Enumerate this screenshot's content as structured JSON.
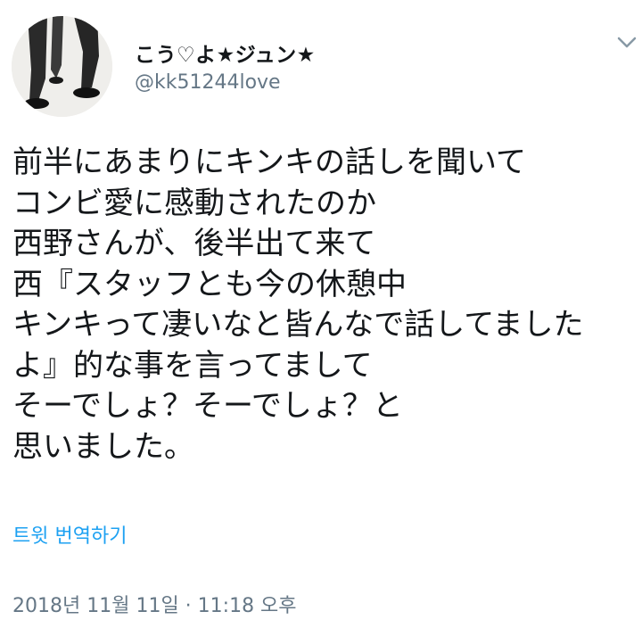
{
  "user": {
    "display_name": "こう♡よ★ジュン★",
    "handle": "@kk51244love"
  },
  "menu": {
    "chevron_icon": "chevron-down-icon"
  },
  "tweet": {
    "lines": [
      "前半にあまりにキンキの話しを聞いて",
      "コンビ愛に感動されたのか",
      "西野さんが、後半出て来て",
      "西『スタッフとも今の休憩中",
      "キンキって凄いなと皆んなで話してました",
      "よ』的な事を言ってまして",
      "そーでしょ？そーでしょ？と",
      "思いました。"
    ],
    "translate_label": "트윗 번역하기",
    "timestamp": "2018년 11월 11일 · 11:18 오후"
  },
  "colors": {
    "text": "#14171a",
    "secondary": "#657786",
    "link": "#1da1f2"
  }
}
